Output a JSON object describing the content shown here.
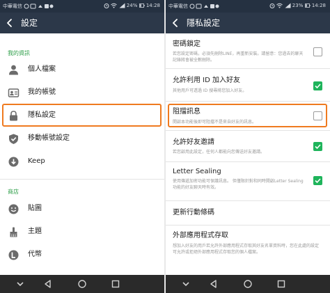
{
  "left": {
    "status_bar": {
      "carrier": "中華電信",
      "battery": "24%",
      "time": "14:28"
    },
    "header": {
      "title": "設定"
    },
    "sections": [
      {
        "header": "我的資訊",
        "items": [
          {
            "label": "個人檔案",
            "icon": "person-icon"
          },
          {
            "label": "我的帳號",
            "icon": "id-card-icon"
          },
          {
            "label": "隱私設定",
            "icon": "lock-icon",
            "highlighted": true
          },
          {
            "label": "移動帳號設定",
            "icon": "shield-check-icon"
          },
          {
            "label": "Keep",
            "icon": "keep-download-icon"
          }
        ]
      },
      {
        "header": "商店",
        "items": [
          {
            "label": "貼圖",
            "icon": "sticker-smiley-icon"
          },
          {
            "label": "主題",
            "icon": "paint-brush-icon"
          },
          {
            "label": "代幣",
            "icon": "coin-icon"
          }
        ]
      }
    ]
  },
  "right": {
    "status_bar": {
      "carrier": "中華電信",
      "battery": "23%",
      "time": "14:28"
    },
    "header": {
      "title": "隱私設定"
    },
    "settings": [
      {
        "title": "密碼鎖定",
        "desc": "若您設定密碼，必須先刪除LINE，再重新安裝。請留意：您過去的聊天記錄將會被全數刪除。",
        "checked": false
      },
      {
        "title": "允許利用 ID 加入好友",
        "desc": "其他用戶可透過 ID 搜尋將您加入好友。",
        "checked": true
      },
      {
        "title": "阻擋訊息",
        "desc": "開啟本功能後即可阻擋不是來自好友的訊息。",
        "checked": false,
        "highlighted": true
      },
      {
        "title": "允許好友邀請",
        "desc": "若您啟用此設定，任何人都能向您傳送好友邀請。",
        "checked": true
      },
      {
        "title": "Letter Sealing",
        "desc": "使用傳遞加密功能可保護訊息。 但僅限針對和同時開啟Letter Sealing功能的好友聊天時有效。",
        "checked": true
      },
      {
        "title": "更新行動條碼"
      },
      {
        "title": "外部應用程式存取",
        "desc": "想加入好友的用戶若允許外部應用程式存取其好友名單資料時，您在此處的設定可允許或拒絕外部應用程式存取您的個人檔案。"
      }
    ]
  },
  "colors": {
    "header_bg": "#2c3849",
    "status_bg": "#253141",
    "accent_green": "#2f9f4a",
    "checkbox_on": "#1fb45b",
    "highlight": "#ef7a1f"
  }
}
